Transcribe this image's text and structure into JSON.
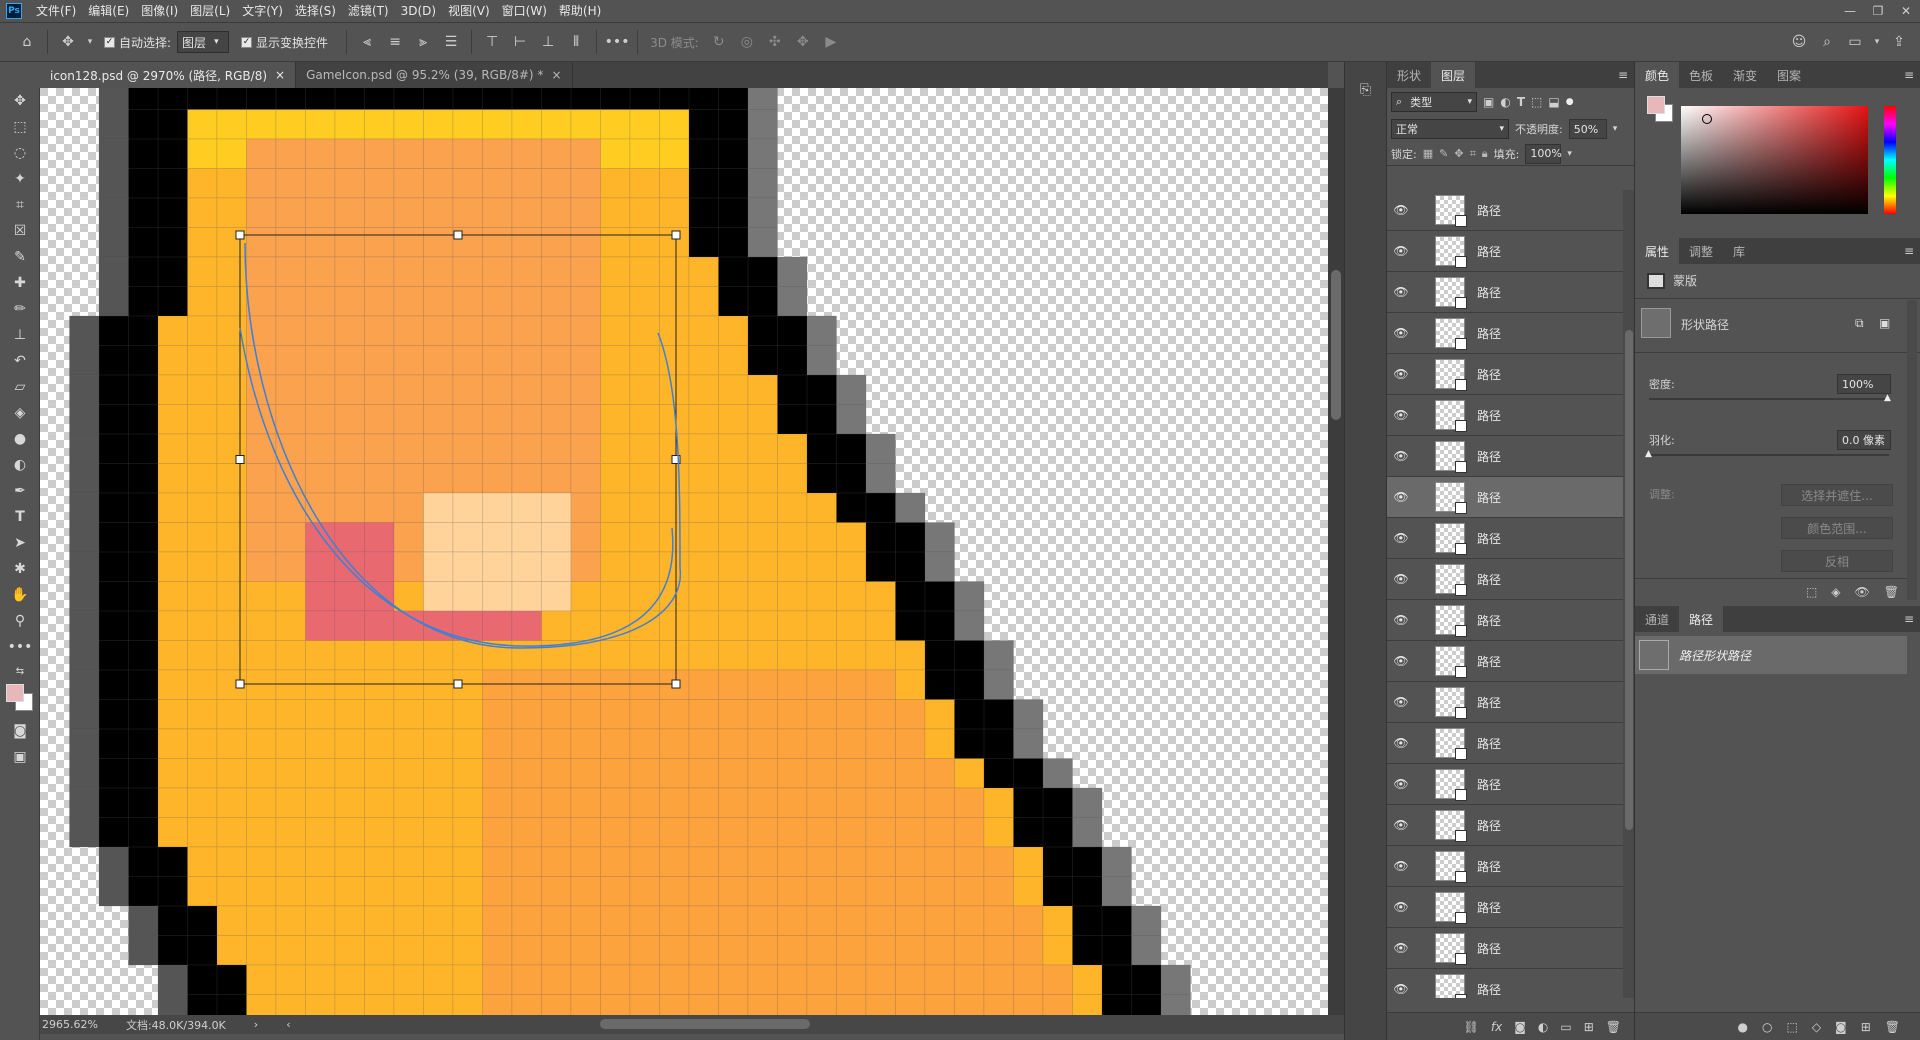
{
  "app": {
    "logo": "Ps"
  },
  "menu": [
    "文件(F)",
    "编辑(E)",
    "图像(I)",
    "图层(L)",
    "文字(Y)",
    "选择(S)",
    "滤镜(T)",
    "3D(D)",
    "视图(V)",
    "窗口(W)",
    "帮助(H)"
  ],
  "options": {
    "auto_select_label": "自动选择:",
    "auto_select_value": "图层",
    "show_transform_label": "显示变换控件",
    "mode_3d_label": "3D 模式:"
  },
  "tabs": [
    {
      "label": "icon128.psd @ 2970% (路径, RGB/8)",
      "close": "×"
    },
    {
      "label": "GameIcon.psd @ 95.2% (39, RGB/8#) *",
      "close": "×"
    }
  ],
  "status": {
    "zoom": "2965.62%",
    "doc": "文档:48.0K/394.0K"
  },
  "layers_panel": {
    "tabs": [
      "形状",
      "图层"
    ],
    "filter_type": "类型",
    "blend_mode": "正常",
    "opacity_label": "不透明度:",
    "opacity_value": "50%",
    "lock_label": "锁定:",
    "fill_label": "填充:",
    "fill_value": "100%",
    "layer_name": "路径",
    "layer_count": 20,
    "selected_index": 7
  },
  "color_panel": {
    "tabs": [
      "颜色",
      "色板",
      "渐变",
      "图案"
    ],
    "fg_color": "#e8b7b9"
  },
  "properties": {
    "tabs": [
      "属性",
      "调整",
      "库"
    ],
    "mask_label": "蒙版",
    "shape_path_label": "形状路径",
    "density_label": "密度:",
    "density_value": "100%",
    "feather_label": "羽化:",
    "feather_value": "0.0 像素",
    "adjust_label": "调整:",
    "select_mask_btn": "选择并遮住...",
    "color_range_btn": "颜色范围...",
    "invert_btn": "反相"
  },
  "paths_panel": {
    "tabs": [
      "通道",
      "路径"
    ],
    "path_item": "路径形状路径"
  },
  "colors": {
    "black": "#000000",
    "yellow": "#ffcc22",
    "orange": "#ffb52a",
    "skin": "#fba24e",
    "pink": "#e86a70",
    "cream": "#ffd39a"
  }
}
